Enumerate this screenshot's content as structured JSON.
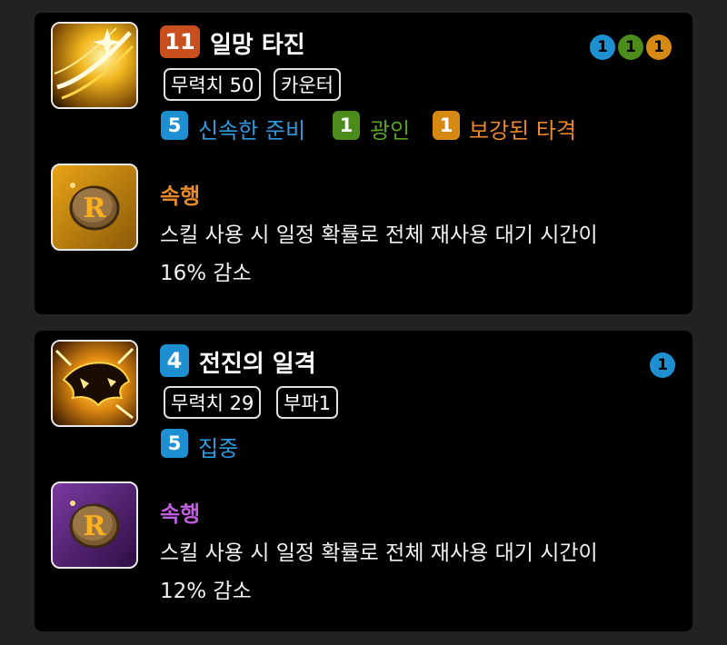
{
  "skills": [
    {
      "level": "11",
      "name": "일망 타진",
      "tags": [
        "무력치 50",
        "카운터"
      ],
      "tripod_dots": [
        "1",
        "1",
        "1"
      ],
      "tripods": [
        {
          "level": "5",
          "name": "신속한 준비"
        },
        {
          "level": "1",
          "name": "광인"
        },
        {
          "level": "1",
          "name": "보강된 타격"
        }
      ],
      "rune": {
        "name": "속행",
        "desc_line1": "스킬 사용 시 일정 확률로 전체 재사용 대기 시간이",
        "desc_line2": "16% 감소"
      }
    },
    {
      "level": "4",
      "name": "전진의 일격",
      "tags": [
        "무력치 29",
        "부파1"
      ],
      "tripod_dots": [
        "1"
      ],
      "tripods": [
        {
          "level": "5",
          "name": "집중"
        }
      ],
      "rune": {
        "name": "속행",
        "desc_line1": "스킬 사용 시 일정 확률로 전체 재사용 대기 시간이",
        "desc_line2": "12% 감소"
      }
    }
  ],
  "colors": {
    "tier1": "#1e8fd0",
    "tier2": "#4c8c1a",
    "tier3": "#d68a12",
    "rune_legendary": "#e8892a",
    "rune_epic": "#c25ee0",
    "level_orange": "#c9501e",
    "level_blue": "#1e8fd0"
  },
  "icons": {
    "skill1": "golden-slash-icon",
    "skill2": "lion-strike-icon",
    "rune": "rune-r-icon"
  }
}
